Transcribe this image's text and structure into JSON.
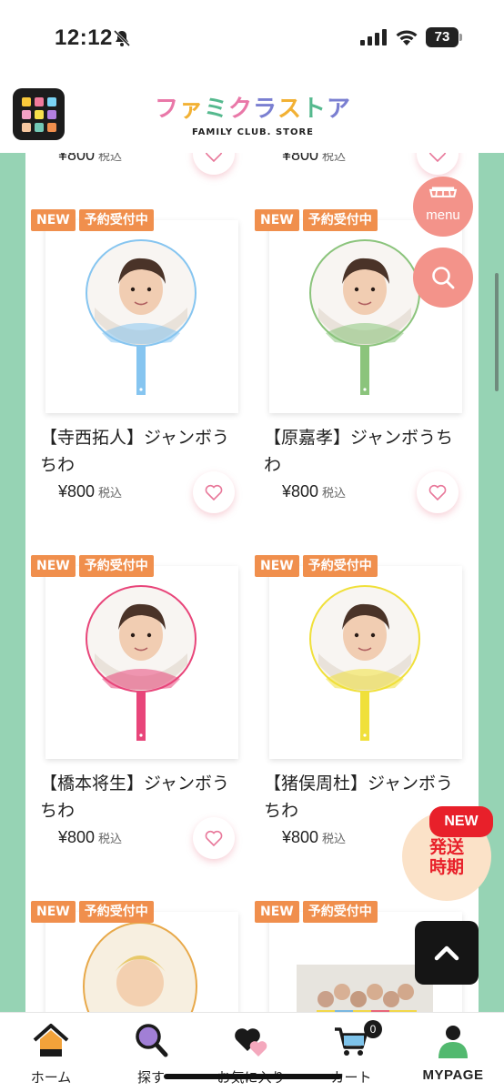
{
  "status": {
    "time": "12:12",
    "battery": "73"
  },
  "header": {
    "logo_chars": [
      "フ",
      "ァ",
      "ミ",
      "ク",
      "ラ",
      "ス",
      "ト",
      "ア"
    ],
    "logo_colors": [
      "#e978a8",
      "#f2b134",
      "#55b98e",
      "#e978a8",
      "#7a7fd1",
      "#f2b134",
      "#55b98e",
      "#7a7fd1"
    ],
    "logo_en": "FAMILY CLUB. STORE",
    "grid_colors": [
      "#f9c93b",
      "#f07a9c",
      "#7ad4f5",
      "#f4a2c6",
      "#f7e04b",
      "#b47fe0",
      "#f6c7a0",
      "#72c9b6",
      "#f08f4d"
    ]
  },
  "top_row": {
    "left": {
      "price": "¥800",
      "tax": "税込"
    },
    "right": {
      "price": "¥800",
      "tax": "税込"
    }
  },
  "badges": {
    "new": "NEW",
    "preorder": "予約受付中"
  },
  "products": [
    {
      "name": "【寺西拓人】ジャンボうちわ",
      "price": "¥800",
      "tax": "税込",
      "color": "#86c5f0"
    },
    {
      "name": "【原嘉孝】ジャンボうちわ",
      "price": "¥800",
      "tax": "税込",
      "color": "#8bc47c"
    },
    {
      "name": "【橋本将生】ジャンボうちわ",
      "price": "¥800",
      "tax": "税込",
      "color": "#e8457a"
    },
    {
      "name": "【猪俣周杜】ジャンボうちわ",
      "price": "¥800",
      "tax": "税込",
      "color": "#f0e03a"
    }
  ],
  "floating": {
    "menu_label": "menu",
    "ship_new": "NEW",
    "ship_text": "発送時期"
  },
  "tabbar": {
    "home": "ホーム",
    "search": "探す",
    "favorites": "お気に入り",
    "cart": "カート",
    "cart_count": "0",
    "mypage": "MYPAGE"
  },
  "colors": {
    "accent": "#f08f4d",
    "side": "#96d3b4",
    "fab": "#f3938a",
    "heart": "#e8789a"
  }
}
